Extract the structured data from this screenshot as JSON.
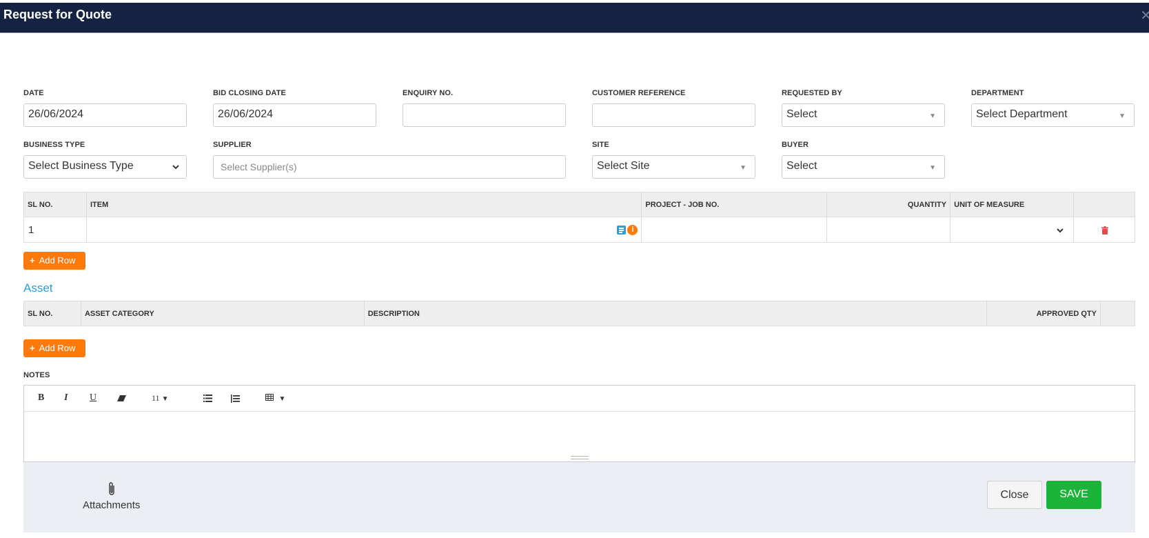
{
  "window": {
    "title": "Request for Quote",
    "close_icon": "close-icon"
  },
  "form": {
    "date": {
      "label": "DATE",
      "value": "26/06/2024"
    },
    "bid_closing_date": {
      "label": "BID CLOSING DATE",
      "value": "26/06/2024"
    },
    "enquiry_no": {
      "label": "ENQUIRY NO.",
      "value": ""
    },
    "customer_reference": {
      "label": "CUSTOMER REFERENCE",
      "value": ""
    },
    "requested_by": {
      "label": "REQUESTED BY",
      "value": "Select"
    },
    "department": {
      "label": "DEPARTMENT",
      "value": "Select Department"
    },
    "business_type": {
      "label": "BUSINESS TYPE",
      "value": "Select Business Type"
    },
    "supplier": {
      "label": "SUPPLIER",
      "placeholder": "Select Supplier(s)"
    },
    "site": {
      "label": "SITE",
      "value": "Select Site"
    },
    "buyer": {
      "label": "BUYER",
      "value": "Select"
    }
  },
  "items_table": {
    "columns": [
      "SL NO.",
      "ITEM",
      "PROJECT - JOB NO.",
      "QUANTITY",
      "UNIT OF MEASURE",
      ""
    ],
    "rows": [
      {
        "sl_no": "1",
        "item": "",
        "project_job_no": "",
        "quantity": "",
        "unit_of_measure": ""
      }
    ],
    "add_row_label": "Add Row"
  },
  "asset_section": {
    "title": "Asset",
    "columns": [
      "SL NO.",
      "ASSET CATEGORY",
      "DESCRIPTION",
      "APPROVED QTY",
      ""
    ],
    "rows": [],
    "add_row_label": "Add Row"
  },
  "notes": {
    "label": "NOTES",
    "toolbar": {
      "bold": "B",
      "italic": "I",
      "underline": "U",
      "font_size": "11"
    },
    "content": ""
  },
  "footer": {
    "attachments_label": "Attachments",
    "close_label": "Close",
    "save_label": "SAVE"
  },
  "colors": {
    "titlebar": "#132341",
    "accent_orange": "#ff7a0a",
    "save_green": "#1cb33b",
    "asset_title": "#2a9fd8",
    "delete_red": "#e84a4a"
  }
}
